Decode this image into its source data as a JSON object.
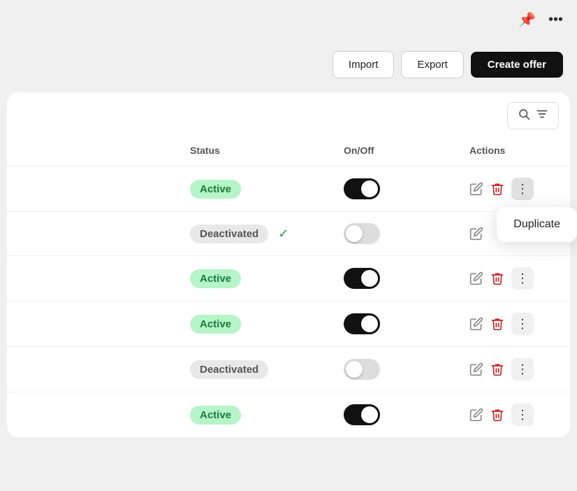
{
  "topbar": {
    "pin_icon": "📌",
    "more_icon": "•••"
  },
  "toolbar": {
    "import_label": "Import",
    "export_label": "Export",
    "create_offer_label": "Create offer"
  },
  "search": {
    "search_icon": "🔍",
    "filter_icon": "≡"
  },
  "table": {
    "columns": [
      "",
      "Status",
      "On/Off",
      "Actions"
    ],
    "rows": [
      {
        "id": 1,
        "status": "Active",
        "status_type": "active",
        "toggle_on": true,
        "show_dropdown": true
      },
      {
        "id": 2,
        "status": "Deactivated",
        "status_type": "deactivated",
        "toggle_on": false,
        "show_check": true,
        "show_dropdown": false
      },
      {
        "id": 3,
        "status": "Active",
        "status_type": "active",
        "toggle_on": true,
        "show_dropdown": false
      },
      {
        "id": 4,
        "status": "Active",
        "status_type": "active",
        "toggle_on": true,
        "show_dropdown": false
      },
      {
        "id": 5,
        "status": "Deactivated",
        "status_type": "deactivated",
        "toggle_on": false,
        "show_dropdown": false
      },
      {
        "id": 6,
        "status": "Active",
        "status_type": "active",
        "toggle_on": true,
        "show_dropdown": false
      }
    ],
    "dropdown": {
      "duplicate_label": "Duplicate"
    }
  }
}
